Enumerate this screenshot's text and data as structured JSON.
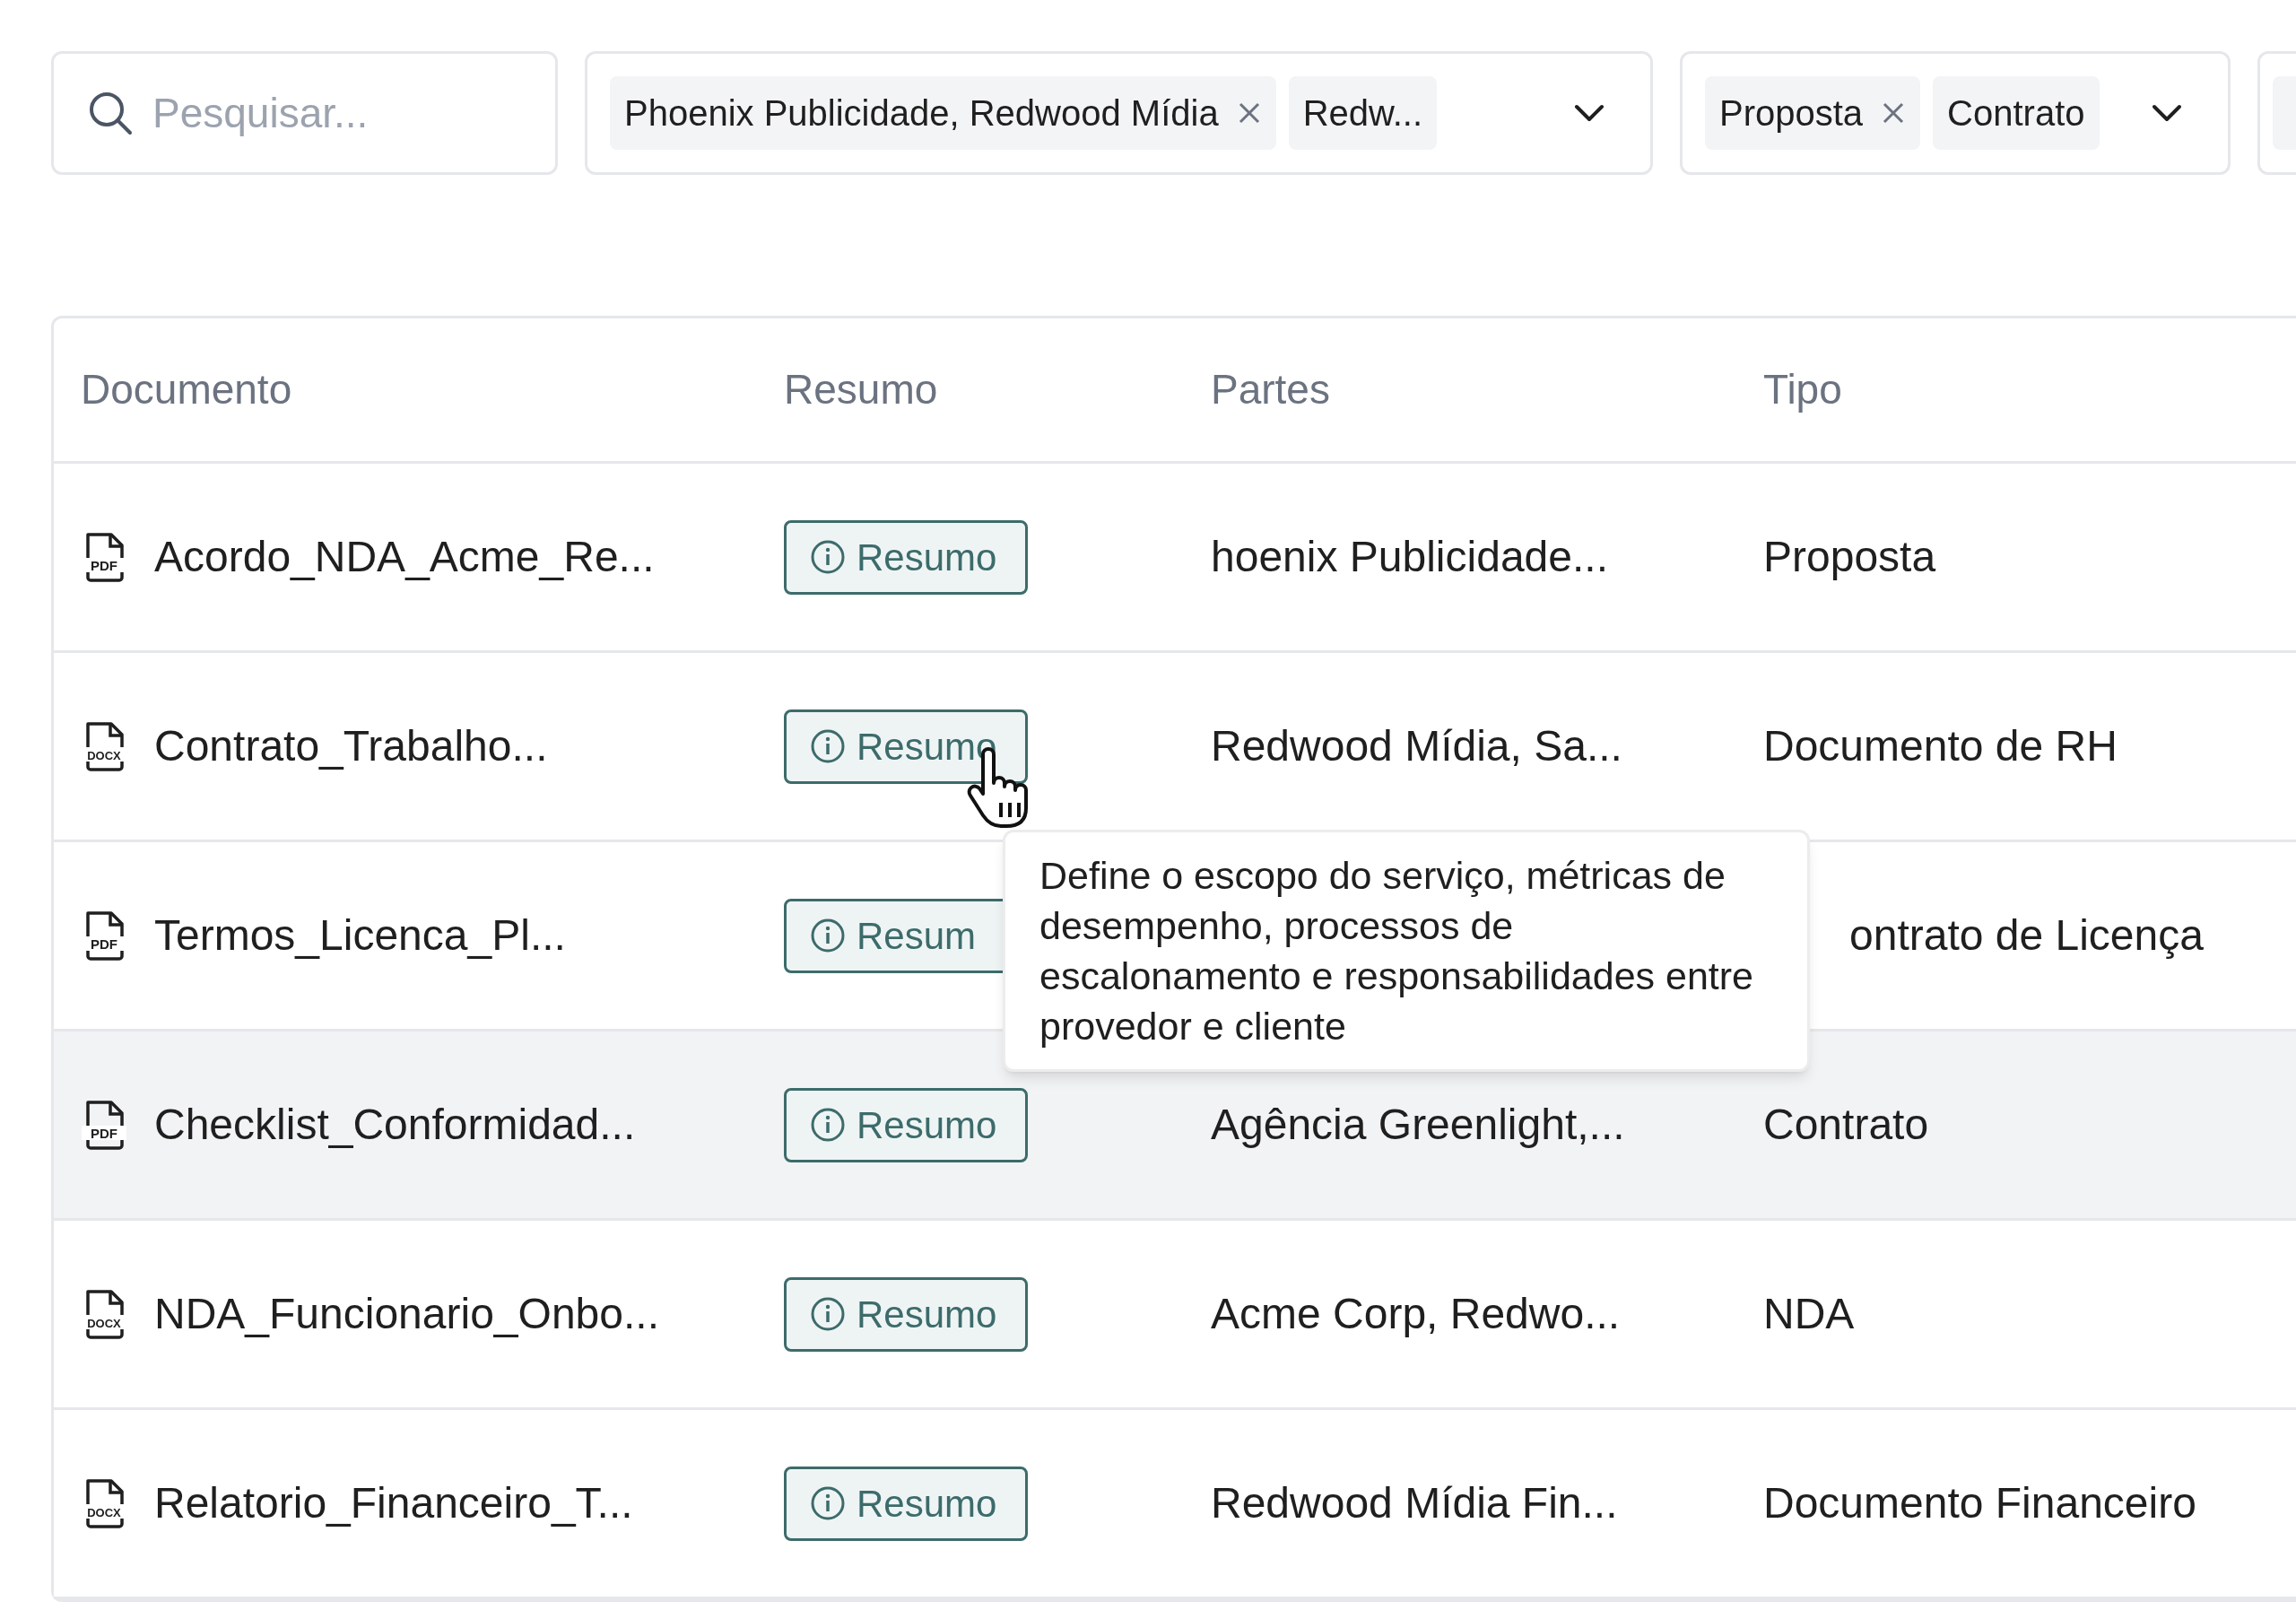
{
  "search": {
    "placeholder": "Pesquisar..."
  },
  "filters": [
    {
      "chips": [
        {
          "label": "Phoenix Publicidade, Redwood Mídia",
          "removable": true
        },
        {
          "label": "Redw...",
          "removable": false
        }
      ]
    },
    {
      "chips": [
        {
          "label": "Proposta",
          "removable": true
        },
        {
          "label": "Contrato",
          "removable": false
        }
      ]
    }
  ],
  "table": {
    "columns": [
      "Documento",
      "Resumo",
      "Partes",
      "Tipo"
    ],
    "rows": [
      {
        "file_type": "PDF",
        "document": "Acordo_NDA_Acme_Re...",
        "summary_button": "Resumo",
        "parties": "hoenix Publicidade...",
        "type": "Proposta",
        "hovered": false
      },
      {
        "file_type": "DOCX",
        "document": "Contrato_Trabalho...",
        "summary_button": "Resumo",
        "parties": "Redwood Mídia, Sa...",
        "type": "Documento de RH",
        "hovered": false
      },
      {
        "file_type": "PDF",
        "document": "Termos_Licenca_Pl...",
        "summary_button": "Resum",
        "type": "ontrato de Licença",
        "hovered": false
      },
      {
        "file_type": "PDF",
        "document": "Checklist_Conformidad...",
        "summary_button": "Resumo",
        "parties": "Agência Greenlight,...",
        "type": "Contrato",
        "hovered": true
      },
      {
        "file_type": "DOCX",
        "document": "NDA_Funcionario_Onbo...",
        "summary_button": "Resumo",
        "parties": "Acme Corp, Redwo...",
        "type": "NDA",
        "hovered": false
      },
      {
        "file_type": "DOCX",
        "document": "Relatorio_Financeiro_T...",
        "summary_button": "Resumo",
        "parties": "Redwood Mídia Fin...",
        "type": "Documento Financeiro",
        "hovered": false
      }
    ]
  },
  "tooltip": {
    "text": "Define o escopo do serviço, métricas de desempenho, processos de escalonamento e responsabilidades entre provedor e cliente"
  }
}
